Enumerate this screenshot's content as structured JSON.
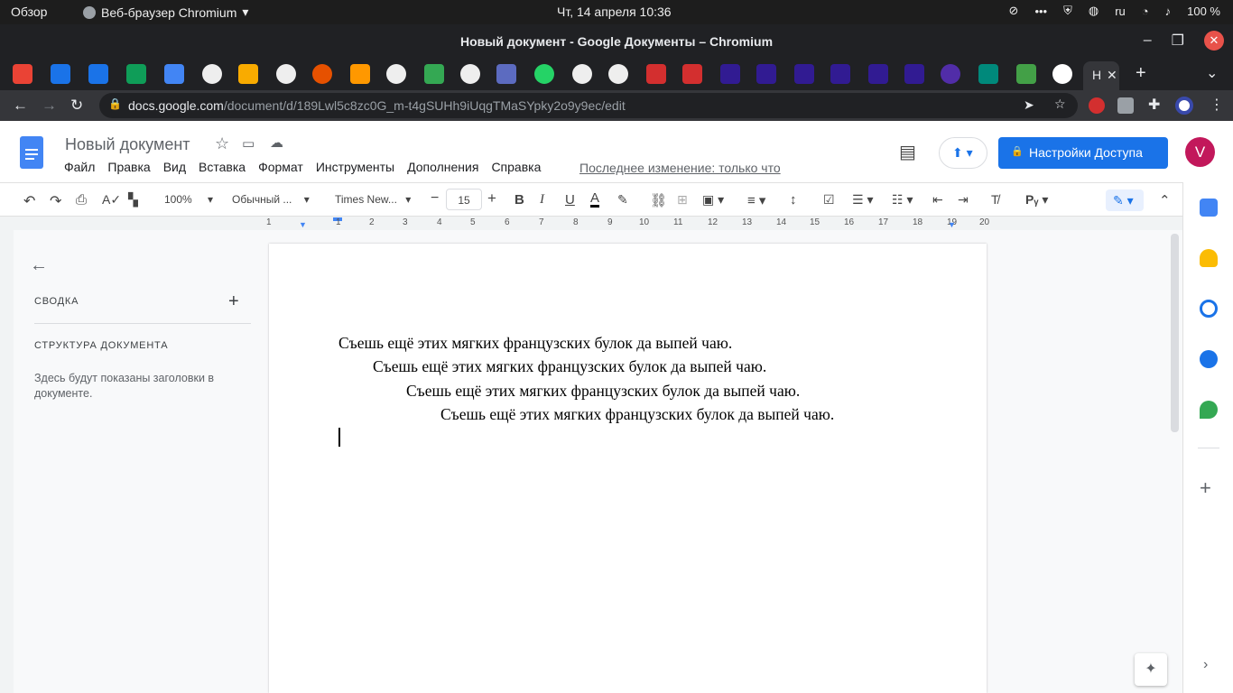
{
  "system": {
    "activities": "Обзор",
    "app_name": "Веб-браузер Chromium",
    "clock": "Чт, 14 апреля  10:36",
    "lang": "ru",
    "battery": "100 %"
  },
  "window": {
    "title": "Новый документ - Google Документы – Chromium"
  },
  "tabs": {
    "active_label": "Н"
  },
  "address": {
    "host": "docs.google.com",
    "path": "/document/d/189Lwl5c8zc0G_m-t4gSUHh9iUqgTMaSYpky2o9y9ec/edit"
  },
  "docs": {
    "title": "Новый документ",
    "menu": [
      "Файл",
      "Правка",
      "Вид",
      "Вставка",
      "Формат",
      "Инструменты",
      "Дополнения",
      "Справка"
    ],
    "last_edit": "Последнее изменение: только что",
    "share": "Настройки Доступа",
    "avatar": "V"
  },
  "toolbar": {
    "zoom": "100%",
    "style": "Обычный ...",
    "font": "Times New...",
    "font_size": "15"
  },
  "ruler": [
    "1",
    "1",
    "2",
    "3",
    "4",
    "5",
    "6",
    "7",
    "8",
    "9",
    "10",
    "11",
    "12",
    "13",
    "14",
    "15",
    "16",
    "17",
    "18",
    "19",
    "20"
  ],
  "outline": {
    "summary": "СВОДКА",
    "structure": "СТРУКТУРА ДОКУМЕНТА",
    "hint": "Здесь будут показаны заголовки в документе."
  },
  "document": {
    "lines": [
      "Съешь ещё этих мягких французских булок да выпей чаю.",
      "Съешь ещё этих мягких французских булок да выпей чаю.",
      "Съешь ещё этих мягких французских булок да выпей чаю.",
      "Съешь ещё этих мягких французских булок да выпей чаю."
    ]
  }
}
